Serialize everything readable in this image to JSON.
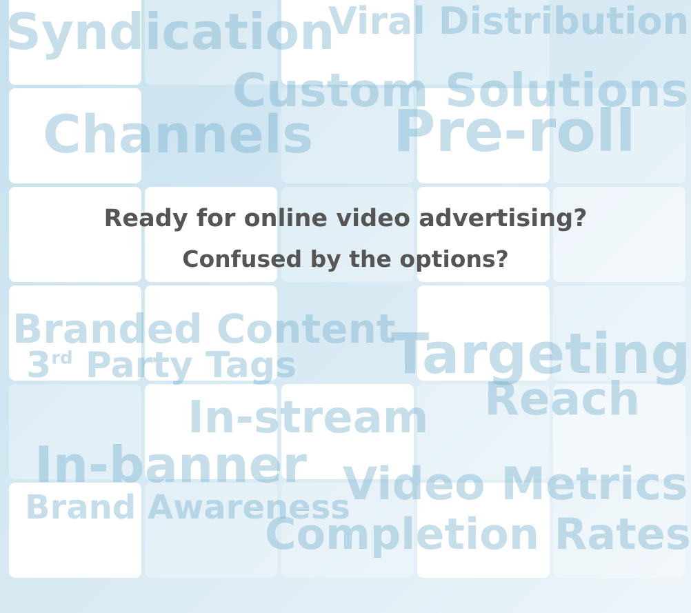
{
  "background_words": [
    {
      "name": "syndication",
      "text": "Syndication"
    },
    {
      "name": "viral-distribution",
      "text": "Viral Distribution"
    },
    {
      "name": "custom-solutions",
      "text": "Custom Solutions"
    },
    {
      "name": "channels",
      "text": "Channels"
    },
    {
      "name": "pre-roll",
      "text": "Pre-roll"
    },
    {
      "name": "branded-content",
      "text": "Branded Content"
    },
    {
      "name": "third-party-tags",
      "text": "3",
      "sup": "rd",
      "rest": " Party Tags"
    },
    {
      "name": "targeting",
      "text": "Targeting"
    },
    {
      "name": "in-stream",
      "text": "In-stream"
    },
    {
      "name": "reach",
      "text": "Reach"
    },
    {
      "name": "in-banner",
      "text": "In-banner"
    },
    {
      "name": "video-metrics",
      "text": "Video Metrics"
    },
    {
      "name": "brand-awareness",
      "text": "Brand Awareness"
    },
    {
      "name": "completion-rates",
      "text": "Completion Rates"
    }
  ],
  "headline": {
    "line1": "Ready for online video advertising?",
    "line2": "Confused by the options?"
  },
  "colors": {
    "headline": "#555555",
    "background_word": "#76b0cd",
    "tile": "#ffffff"
  }
}
